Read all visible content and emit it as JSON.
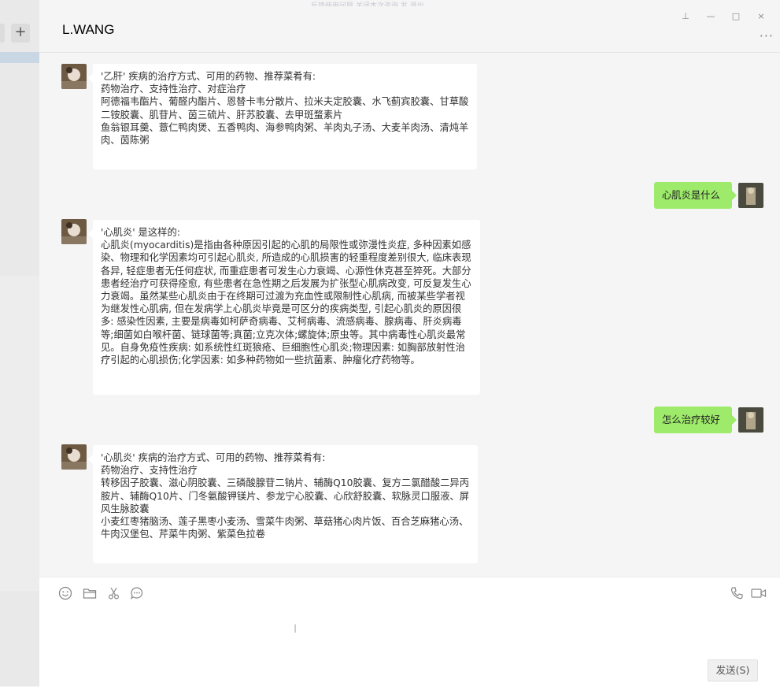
{
  "top_faded_text": "反馈使用问题    关闭本次咨询    发    退出",
  "sidebar": {
    "add_label": "+"
  },
  "header": {
    "title": "L.WANG",
    "more": "···"
  },
  "window_controls": {
    "pin": "⊥",
    "minimize": "—",
    "maximize": "□",
    "close": "×"
  },
  "messages": [
    {
      "side": "left",
      "text": "'乙肝' 疾病的治疗方式、可用的药物、推荐菜肴有:\n药物治疗、支持性治疗、对症治疗\n阿德福韦酯片、葡醛内酯片、恩替卡韦分散片、拉米夫定胶囊、水飞蓟宾胶囊、甘草酸二铵胶囊、肌苷片、茵三硫片、肝苏胶囊、去甲斑蝥素片\n鱼翁银耳羹、薏仁鸭肉煲、五香鸭肉、海参鸭肉粥、羊肉丸子汤、大麦羊肉汤、清炖羊肉、茵陈粥"
    },
    {
      "side": "right",
      "text": "心肌炎是什么"
    },
    {
      "side": "left",
      "text": "'心肌炎' 是这样的:\n心肌炎(myocarditis)是指由各种原因引起的心肌的局限性或弥漫性炎症, 多种因素如感染、物理和化学因素均可引起心肌炎, 所造成的心肌损害的轻重程度差别很大, 临床表现各异, 轻症患者无任何症状, 而重症患者可发生心力衰竭、心源性休克甚至猝死。大部分患者经治疗可获得痊愈, 有些患者在急性期之后发展为扩张型心肌病改变, 可反复发生心力衰竭。虽然某些心肌炎由于在终期可过渡为充血性或限制性心肌病, 而被某些学者视为继发性心肌病, 但在发病学上心肌炎毕竟是可区分的疾病类型, 引起心肌炎的原因很多: 感染性因素, 主要是病毒如柯萨奇病毒、艾柯病毒、流感病毒、腺病毒、肝炎病毒等;细菌如白喉杆菌、链球菌等;真菌;立克次体;螺旋体;原虫等。其中病毒性心肌炎最常见。自身免疫性疾病: 如系统性红斑狼疮、巨细胞性心肌炎;物理因素: 如胸部放射性治疗引起的心肌损伤;化学因素: 如多种药物如一些抗菌素、肿瘤化疗药物等。"
    },
    {
      "side": "right",
      "text": "怎么治疗较好"
    },
    {
      "side": "left",
      "text": "'心肌炎' 疾病的治疗方式、可用的药物、推荐菜肴有:\n药物治疗、支持性治疗\n转移因子胶囊、滋心阴胶囊、三磷酸腺苷二钠片、辅酶Q10胶囊、复方二氯醋酸二异丙胺片、辅酶Q10片、门冬氨酸钾镁片、参龙宁心胶囊、心欣舒胶囊、软脉灵口服液、屏风生脉胶囊\n小麦红枣猪脑汤、莲子黑枣小麦汤、雪菜牛肉粥、草菇猪心肉片饭、百合芝麻猪心汤、牛肉汉堡包、芹菜牛肉粥、紫菜色拉卷"
    }
  ],
  "composer": {
    "tools": [
      "emoji-icon",
      "folder-icon",
      "scissors-icon",
      "chat-history-icon",
      "phone-icon",
      "video-icon"
    ],
    "send_label": "发送(S)"
  },
  "footer_faded": "     "
}
